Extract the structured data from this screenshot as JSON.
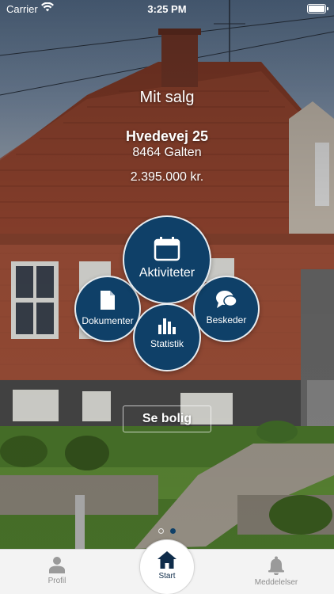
{
  "status_bar": {
    "carrier": "Carrier",
    "time": "3:25 PM"
  },
  "header": {
    "title": "Mit salg",
    "street": "Hvedevej 25",
    "city": "8464 Galten",
    "price": "2.395.000 kr."
  },
  "menu": {
    "aktiviteter": {
      "label": "Aktiviteter",
      "icon": "calendar-icon"
    },
    "dokumenter": {
      "label": "Dokumenter",
      "icon": "document-icon"
    },
    "beskeder": {
      "label": "Beskeder",
      "icon": "chat-bubble-icon"
    },
    "statistik": {
      "label": "Statistik",
      "icon": "bar-chart-icon"
    }
  },
  "see_house_button": "Se bolig",
  "page_dots": {
    "count": 2,
    "active_index": 1
  },
  "tab_bar": {
    "profil": {
      "label": "Profil",
      "icon": "person-icon"
    },
    "start": {
      "label": "Start",
      "icon": "home-icon"
    },
    "meddelelser": {
      "label": "Meddelelser",
      "icon": "bell-icon"
    }
  },
  "colors": {
    "accent": "#0f4068",
    "tab_inactive": "#8d8d8d",
    "tab_active": "#0f2c4a"
  }
}
